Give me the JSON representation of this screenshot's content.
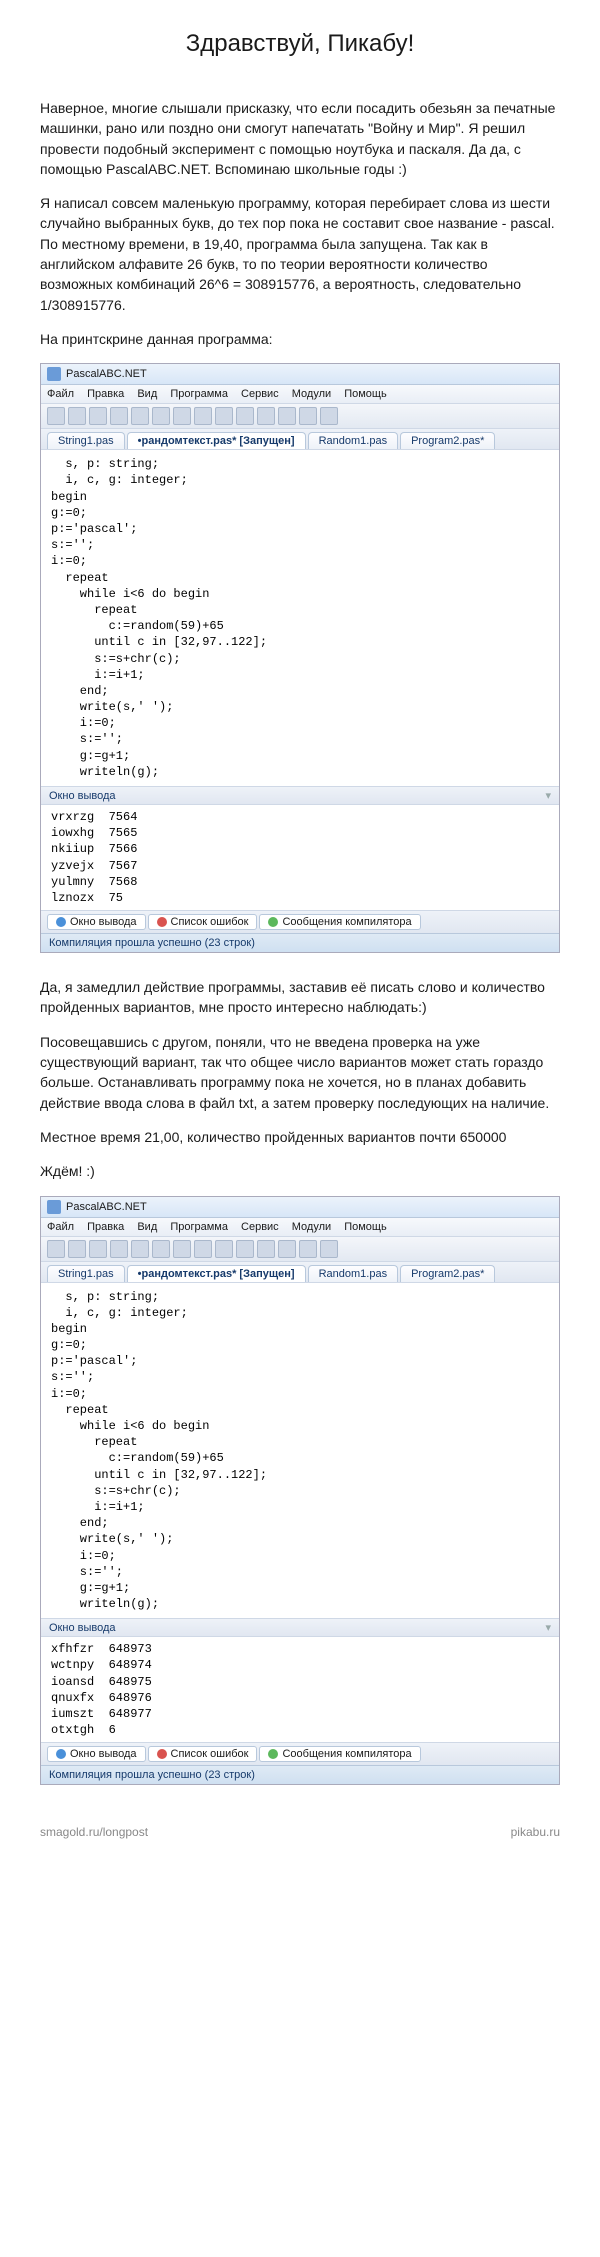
{
  "title": "Здравствуй, Пикабу!",
  "para1": "Наверное, многие слышали присказку, что если посадить обезьян за печатные машинки, рано или поздно они смогут напечатать \"Войну и Мир\". Я решил провести подобный эксперимент с помощью ноутбука и паскаля. Да да, с помощью PascalABC.NET. Вспоминаю школьные годы :)",
  "para2": "Я написал совсем маленькую программу, которая перебирает слова из шести случайно выбранных букв, до тех пор пока не составит свое название - pascal. По местному времени, в 19,40, программа была запущена. Так как в английском алфавите 26 букв, то по теории вероятности количество возможных комбинаций 26^6 = 308915776, а вероятность, следовательно 1/308915776.",
  "para3": "На принтскрине данная программа:",
  "para4": "Да, я замедлил действие программы, заставив её писать слово и количество пройденных вариантов, мне просто интересно наблюдать:)",
  "para5": "Посовещавшись с другом, поняли, что не введена проверка на уже существующий вариант, так что общее число вариантов может стать гораздо больше. Останавливать программу пока не хочется, но в планах добавить действие ввода слова в файл txt, а затем проверку последующих на наличие.",
  "para6": "Местное время 21,00, количество пройденных вариантов почти 650000",
  "para7": "Ждём! :)",
  "ide": {
    "title": "PascalABC.NET",
    "menu": [
      "Файл",
      "Правка",
      "Вид",
      "Программа",
      "Сервис",
      "Модули",
      "Помощь"
    ],
    "tabs": [
      "String1.pas",
      "•рандомтекст.pas* [Запущен]",
      "Random1.pas",
      "Program2.pas*"
    ],
    "activeTab": 1,
    "code": "  s, p: string;\n  i, c, g: integer;\nbegin\ng:=0;\np:='pascal';\ns:='';\ni:=0;\n  repeat\n    while i<6 do begin\n      repeat\n        c:=random(59)+65\n      until c in [32,97..122];\n      s:=s+chr(c);\n      i:=i+1;\n    end;\n    write(s,' ');\n    i:=0;\n    s:='';\n    g:=g+1;\n    writeln(g);",
    "outPanelTitle": "Окно вывода",
    "bottomTabs": [
      "Окно вывода",
      "Список ошибок",
      "Сообщения компилятора"
    ],
    "status": "Компиляция прошла успешно (23 строк)"
  },
  "output1": "vrxrzg  7564\niowxhg  7565\nnkiiup  7566\nyzvejx  7567\nyulmny  7568\nlznozx  75",
  "output2": "xfhfzr  648973\nwctnpy  648974\nioansd  648975\nqnuxfx  648976\niumszt  648977\notxtgh  6",
  "footer": {
    "left": "smagold.ru/longpost",
    "right": "pikabu.ru"
  }
}
